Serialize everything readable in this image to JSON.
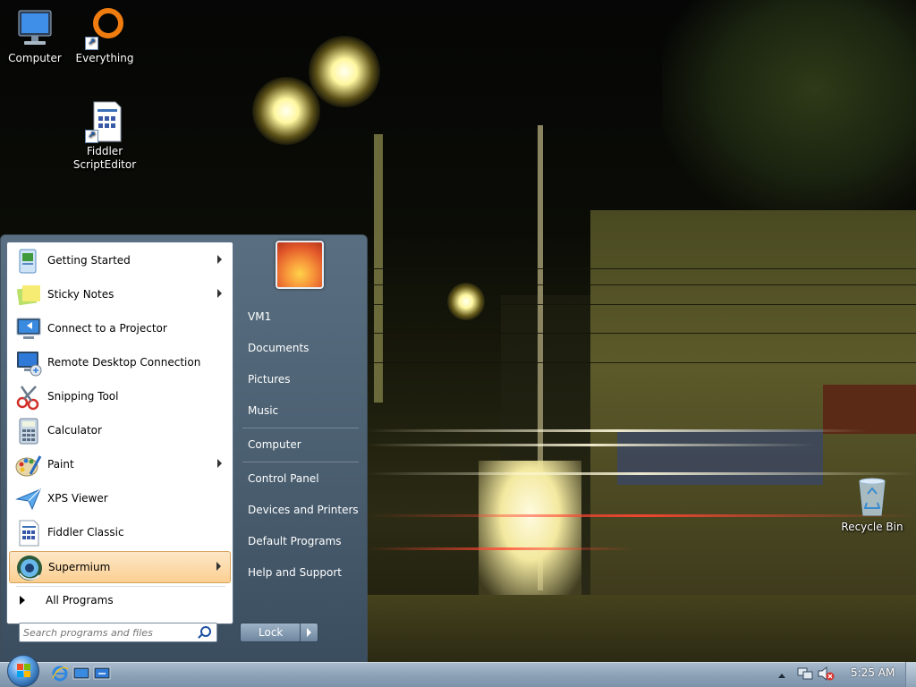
{
  "desktop": {
    "icons": [
      {
        "label": "Computer",
        "icon": "computer-icon"
      },
      {
        "label": "Everything",
        "icon": "everything-icon"
      },
      {
        "label_line1": "Fiddler",
        "label_line2": "ScriptEditor",
        "icon": "fiddler-scripteditor-icon"
      },
      {
        "label": "Recycle Bin",
        "icon": "recycle-bin-icon"
      }
    ]
  },
  "start_menu": {
    "programs": [
      {
        "label": "Getting Started",
        "icon": "getting-started-icon",
        "has_submenu": true
      },
      {
        "label": "Sticky Notes",
        "icon": "sticky-notes-icon",
        "has_submenu": true
      },
      {
        "label": "Connect to a Projector",
        "icon": "projector-icon",
        "has_submenu": false
      },
      {
        "label": "Remote Desktop Connection",
        "icon": "remote-desktop-icon",
        "has_submenu": false
      },
      {
        "label": "Snipping Tool",
        "icon": "snipping-tool-icon",
        "has_submenu": false
      },
      {
        "label": "Calculator",
        "icon": "calculator-icon",
        "has_submenu": false
      },
      {
        "label": "Paint",
        "icon": "paint-icon",
        "has_submenu": true
      },
      {
        "label": "XPS Viewer",
        "icon": "xps-viewer-icon",
        "has_submenu": false
      },
      {
        "label": "Fiddler Classic",
        "icon": "fiddler-icon",
        "has_submenu": false
      },
      {
        "label": "Supermium",
        "icon": "supermium-icon",
        "has_submenu": true,
        "highlighted": true
      }
    ],
    "all_programs_label": "All Programs",
    "search_placeholder": "Search programs and files",
    "right_items": [
      "VM1",
      "Documents",
      "Pictures",
      "Music",
      "Computer",
      "Control Panel",
      "Devices and Printers",
      "Default Programs",
      "Help and Support"
    ],
    "lock_label": "Lock"
  },
  "taskbar": {
    "pinned": [
      "internet-explorer-icon",
      "windows-explorer-icon",
      "remote-desktop-icon"
    ],
    "clock": "5:25 AM",
    "tray_icons": [
      "show-hidden-icons-icon",
      "network-icon",
      "volume-muted-icon"
    ]
  },
  "colors": {
    "highlight": "#fbcf91",
    "taskbar": "#8ea3b8",
    "menu_right_pane": "#5a7690"
  }
}
